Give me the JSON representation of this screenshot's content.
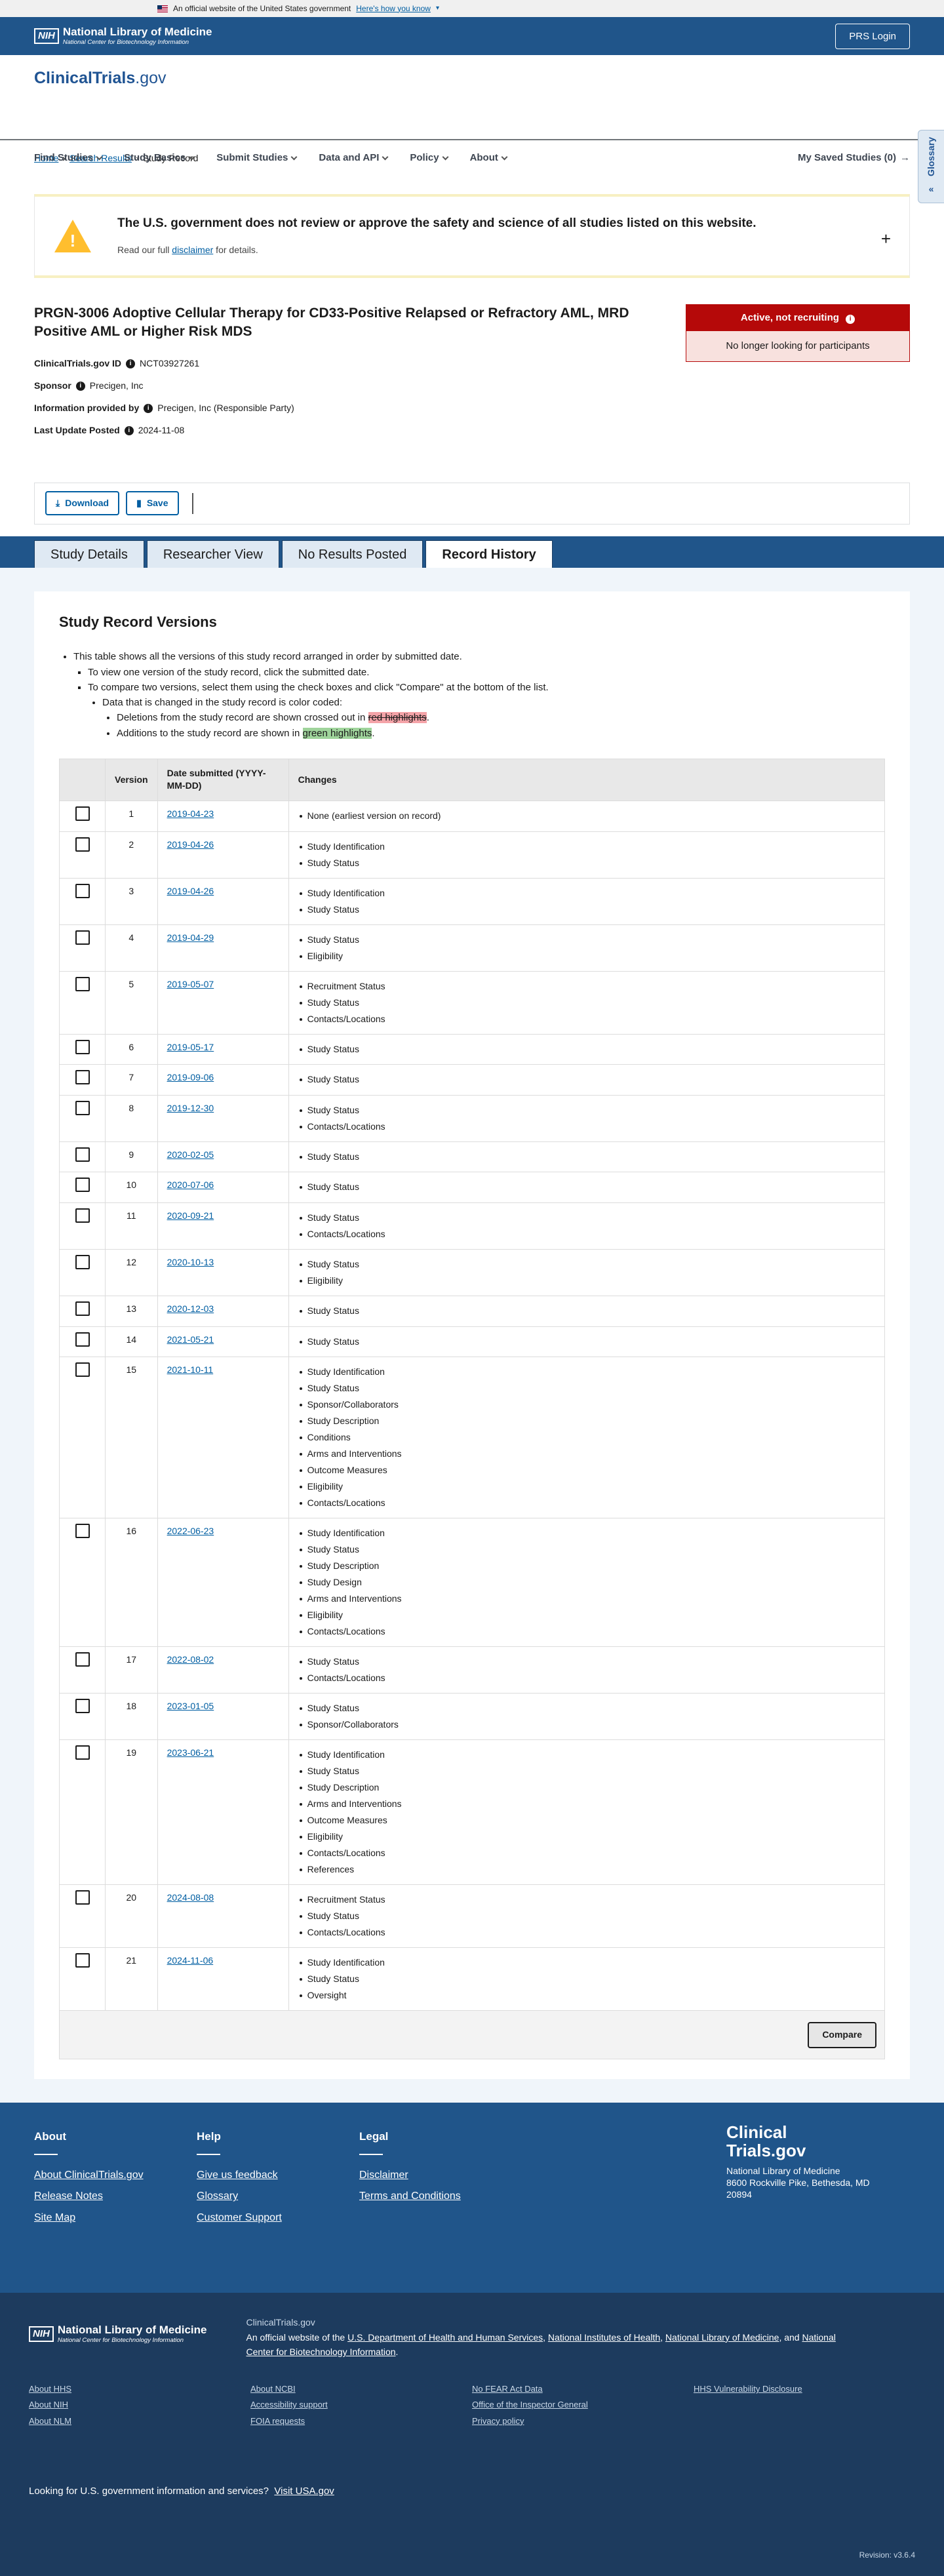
{
  "gov_banner": {
    "text": "An official website of the United States government",
    "link": "Here's how you know"
  },
  "nih": {
    "abbr": "NIH",
    "title": "National Library of Medicine",
    "subtitle": "National Center for Biotechnology Information",
    "prs_login": "PRS Login"
  },
  "site": {
    "logo_main": "ClinicalTrials",
    "logo_suffix": ".gov"
  },
  "nav": {
    "items": [
      "Find Studies",
      "Study Basics",
      "Submit Studies",
      "Data and API",
      "Policy",
      "About"
    ],
    "saved": "My Saved Studies (0)"
  },
  "breadcrumb": {
    "home": "Home",
    "search": "Search Results",
    "current": "Study Record"
  },
  "glossary": {
    "label": "Glossary"
  },
  "disclaimer": {
    "heading": "The U.S. government does not review or approve the safety and science of all studies listed on this website.",
    "pre": "Read our full ",
    "link": "disclaimer",
    "post": " for details."
  },
  "study": {
    "title": "PRGN-3006 Adoptive Cellular Therapy for CD33-Positive Relapsed or Refractory AML, MRD Positive AML or Higher Risk MDS",
    "id_label": "ClinicalTrials.gov ID",
    "id_value": "NCT03927261",
    "sponsor_label": "Sponsor",
    "sponsor_value": "Precigen, Inc",
    "info_label": "Information provided by",
    "info_value": "Precigen, Inc (Responsible Party)",
    "update_label": "Last Update Posted",
    "update_value": "2024-11-08",
    "status": "Active, not recruiting",
    "status_sub": "No longer looking for participants"
  },
  "actions": {
    "download": "Download",
    "save": "Save"
  },
  "tabs": [
    "Study Details",
    "Researcher View",
    "No Results Posted",
    "Record History"
  ],
  "versions_section": {
    "title": "Study Record Versions",
    "note1": "This table shows all the versions of this study record arranged in order by submitted date.",
    "note2": "To view one version of the study record, click the submitted date.",
    "note3": "To compare two versions, select them using the check boxes and click \"Compare\" at the bottom of the list.",
    "note4": "Data that is changed in the study record is color coded:",
    "note5_pre": "Deletions from the study record are shown crossed out in ",
    "note5_hl": "red highlights",
    "note5_post": ".",
    "note6_pre": "Additions to the study record are shown in ",
    "note6_hl": "green highlights",
    "note6_post": ".",
    "col_version": "Version",
    "col_date": "Date submitted (YYYY-MM-DD)",
    "col_changes": "Changes",
    "compare": "Compare",
    "rows": [
      {
        "v": "1",
        "d": "2019-04-23",
        "c": [
          "None (earliest version on record)"
        ]
      },
      {
        "v": "2",
        "d": "2019-04-26",
        "c": [
          "Study Identification",
          "Study Status"
        ]
      },
      {
        "v": "3",
        "d": "2019-04-26",
        "c": [
          "Study Identification",
          "Study Status"
        ]
      },
      {
        "v": "4",
        "d": "2019-04-29",
        "c": [
          "Study Status",
          "Eligibility"
        ]
      },
      {
        "v": "5",
        "d": "2019-05-07",
        "c": [
          "Recruitment Status",
          "Study Status",
          "Contacts/Locations"
        ]
      },
      {
        "v": "6",
        "d": "2019-05-17",
        "c": [
          "Study Status"
        ]
      },
      {
        "v": "7",
        "d": "2019-09-06",
        "c": [
          "Study Status"
        ]
      },
      {
        "v": "8",
        "d": "2019-12-30",
        "c": [
          "Study Status",
          "Contacts/Locations"
        ]
      },
      {
        "v": "9",
        "d": "2020-02-05",
        "c": [
          "Study Status"
        ]
      },
      {
        "v": "10",
        "d": "2020-07-06",
        "c": [
          "Study Status"
        ]
      },
      {
        "v": "11",
        "d": "2020-09-21",
        "c": [
          "Study Status",
          "Contacts/Locations"
        ]
      },
      {
        "v": "12",
        "d": "2020-10-13",
        "c": [
          "Study Status",
          "Eligibility"
        ]
      },
      {
        "v": "13",
        "d": "2020-12-03",
        "c": [
          "Study Status"
        ]
      },
      {
        "v": "14",
        "d": "2021-05-21",
        "c": [
          "Study Status"
        ]
      },
      {
        "v": "15",
        "d": "2021-10-11",
        "c": [
          "Study Identification",
          "Study Status",
          "Sponsor/Collaborators",
          "Study Description",
          "Conditions",
          "Arms and Interventions",
          "Outcome Measures",
          "Eligibility",
          "Contacts/Locations"
        ]
      },
      {
        "v": "16",
        "d": "2022-06-23",
        "c": [
          "Study Identification",
          "Study Status",
          "Study Description",
          "Study Design",
          "Arms and Interventions",
          "Eligibility",
          "Contacts/Locations"
        ]
      },
      {
        "v": "17",
        "d": "2022-08-02",
        "c": [
          "Study Status",
          "Contacts/Locations"
        ]
      },
      {
        "v": "18",
        "d": "2023-01-05",
        "c": [
          "Study Status",
          "Sponsor/Collaborators"
        ]
      },
      {
        "v": "19",
        "d": "2023-06-21",
        "c": [
          "Study Identification",
          "Study Status",
          "Study Description",
          "Arms and Interventions",
          "Outcome Measures",
          "Eligibility",
          "Contacts/Locations",
          "References"
        ]
      },
      {
        "v": "20",
        "d": "2024-08-08",
        "c": [
          "Recruitment Status",
          "Study Status",
          "Contacts/Locations"
        ]
      },
      {
        "v": "21",
        "d": "2024-11-06",
        "c": [
          "Study Identification",
          "Study Status",
          "Oversight"
        ]
      }
    ]
  },
  "footer": {
    "about_h": "About",
    "about_links": [
      "About ClinicalTrials.gov",
      "Release Notes",
      "Site Map"
    ],
    "help_h": "Help",
    "help_links": [
      "Give us feedback",
      "Glossary",
      "Customer Support"
    ],
    "legal_h": "Legal",
    "legal_links": [
      "Disclaimer",
      "Terms and Conditions"
    ],
    "logo_l1": "Clinical",
    "logo_l2": "Trials.gov",
    "org": "National Library of Medicine",
    "addr": "8600 Rockville Pike, Bethesda, MD 20894"
  },
  "bottom": {
    "site": "ClinicalTrials.gov",
    "official_pre": "An official website of the ",
    "l1": "U.S. Department of Health and Human Services",
    "sep1": ", ",
    "l2": "National Institutes of Health",
    "sep2": ", ",
    "l3": "National Library of Medicine",
    "sep3": ", and ",
    "l4": "National Center for Biotechnology Information",
    "end": ".",
    "links": [
      "About HHS",
      "About NCBI",
      "No FEAR Act Data",
      "HHS Vulnerability Disclosure",
      "About NIH",
      "Accessibility support",
      "Office of the Inspector General",
      "",
      "About NLM",
      "FOIA requests",
      "Privacy policy",
      ""
    ],
    "usa_pre": "Looking for U.S. government information and services?",
    "usa_link": "Visit USA.gov",
    "revision": "Revision: v3.6.4"
  }
}
